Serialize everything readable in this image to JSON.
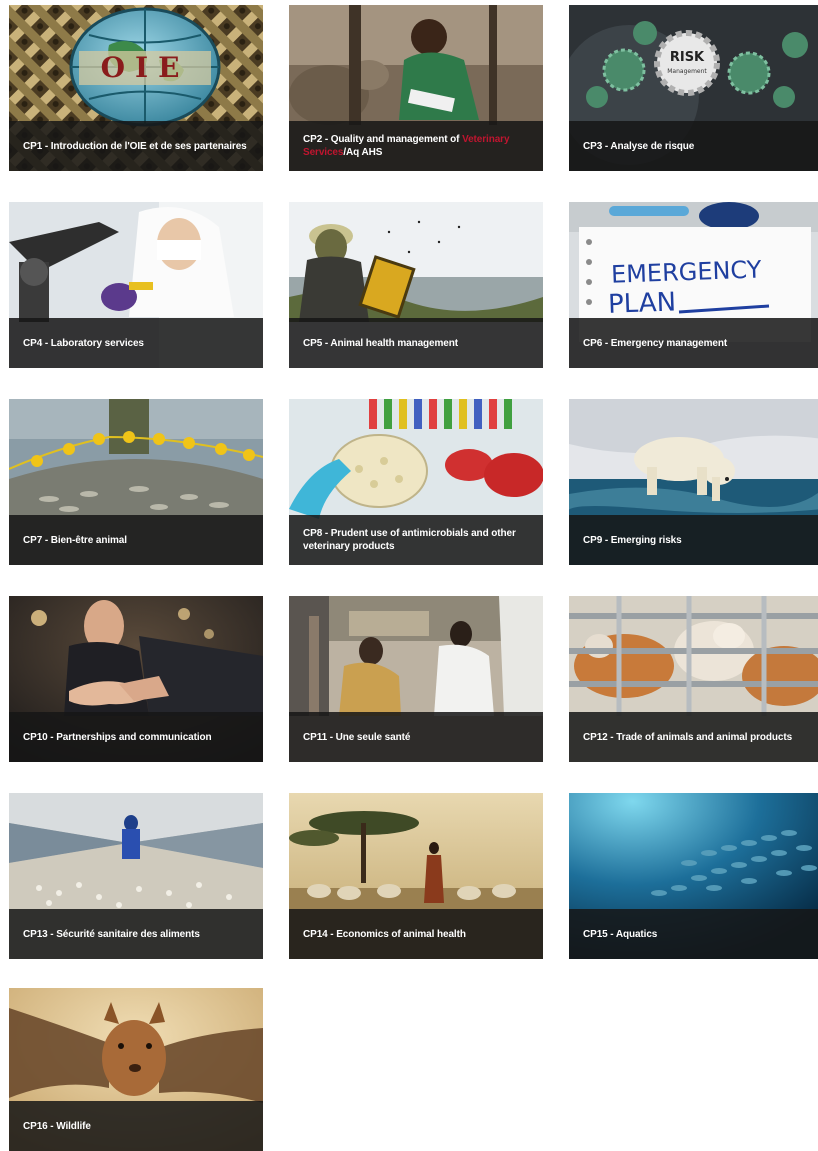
{
  "cards": [
    {
      "id": "cp1",
      "label": "CP1 - Introduction de l'OIE et de ses partenaires",
      "image": "oie-globe-emblem"
    },
    {
      "id": "cp2",
      "label_before": "CP2 - Quality and management of ",
      "label_highlight": "Veterinary Services",
      "label_after": "/Aq AHS",
      "image": "field-worker-writing",
      "highlight_color": "#c0152f"
    },
    {
      "id": "cp3",
      "label": "CP3 - Analyse de risque",
      "image": "risk-management-gears"
    },
    {
      "id": "cp4",
      "label": "CP4 - Laboratory services",
      "image": "lab-scientist-microscope"
    },
    {
      "id": "cp5",
      "label": "CP5 - Animal health management",
      "image": "beekeeper-honeycomb"
    },
    {
      "id": "cp6",
      "label": "CP6 - Emergency management",
      "image": "emergency-plan-notepad",
      "image_text": "EMERGENCY PLAN"
    },
    {
      "id": "cp7",
      "label": "CP7 - Bien-être animal",
      "image": "fishing-net-fish"
    },
    {
      "id": "cp8",
      "label": "CP8 - Prudent use of antimicrobials and other veterinary products",
      "image": "petri-dish-lab"
    },
    {
      "id": "cp9",
      "label": "CP9 - Emerging risks",
      "image": "polar-bear-ice"
    },
    {
      "id": "cp10",
      "label": "CP10 - Partnerships and communication",
      "image": "business-handshake"
    },
    {
      "id": "cp11",
      "label": "CP11 - Une seule santé",
      "image": "people-community"
    },
    {
      "id": "cp12",
      "label": "CP12 - Trade of animals and animal products",
      "image": "cattle-in-pen"
    },
    {
      "id": "cp13",
      "label": "CP13 - Sécurité sanitaire des aliments",
      "image": "poultry-farm"
    },
    {
      "id": "cp14",
      "label": "CP14 - Economics of animal health",
      "image": "herder-with-sheep"
    },
    {
      "id": "cp15",
      "label": "CP15 - Aquatics",
      "image": "school-of-fish-underwater"
    },
    {
      "id": "cp16",
      "label": "CP16 - Wildlife",
      "image": "fruit-bat"
    }
  ]
}
